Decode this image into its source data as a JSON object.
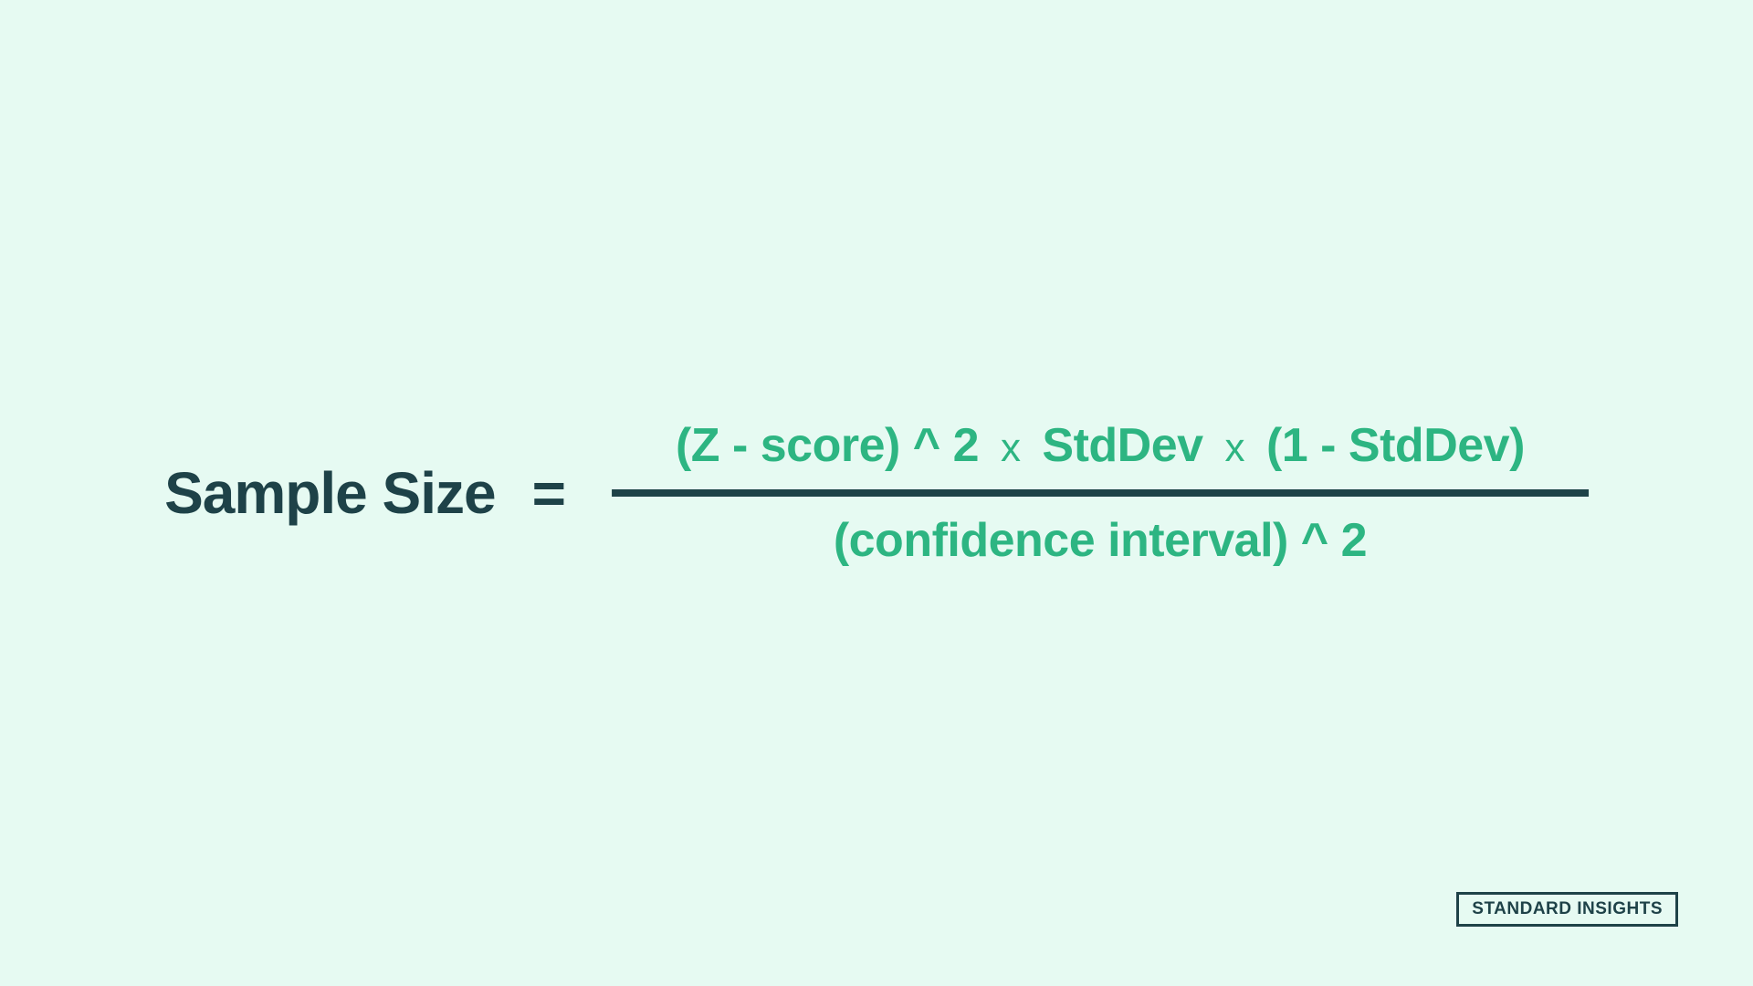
{
  "formula": {
    "left_label": "Sample Size",
    "equals": "=",
    "numerator": {
      "part1": "(Z - score) ^ 2",
      "mult1": "x",
      "part2": "StdDev",
      "mult2": "x",
      "part3": "(1 - StdDev)"
    },
    "denominator": "(confidence interval) ^ 2"
  },
  "brand": "STANDARD INSIGHTS"
}
